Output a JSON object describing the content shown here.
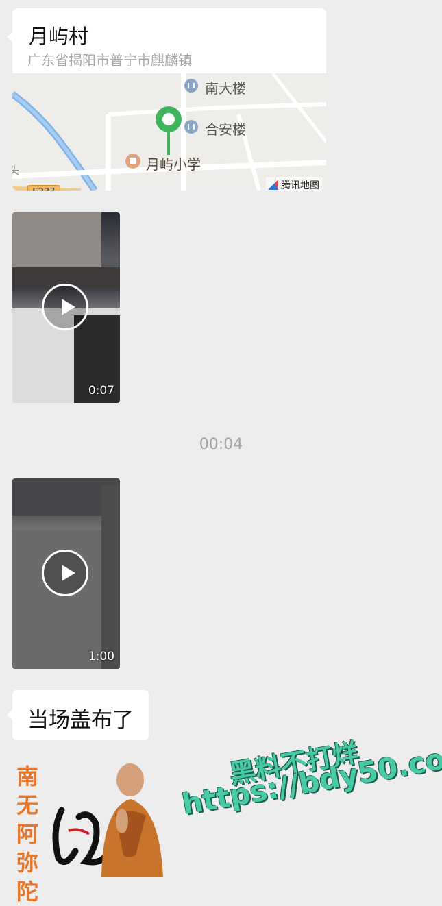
{
  "location_message": {
    "name": "月屿村",
    "address": "广东省揭阳市普宁市麒麟镇",
    "map": {
      "poi_1": "南大楼",
      "poi_2": "合安楼",
      "poi_3": "月屿小学",
      "route": "S237",
      "provider": "腾讯地图",
      "partial_label": "头",
      "pin_color": "#3fb45c"
    }
  },
  "videos": [
    {
      "duration": "0:07"
    },
    {
      "duration": "1:00"
    }
  ],
  "timestamp": "00:04",
  "text_message": "当场盖布了",
  "overlay_ad": {
    "vertical_chars": [
      "南",
      "无",
      "阿",
      "弥",
      "陀"
    ],
    "line1": "黑料不打烊",
    "line2": "https://bdy50.co",
    "text_color": "#47cba7",
    "vertical_color": "#e8762a"
  }
}
